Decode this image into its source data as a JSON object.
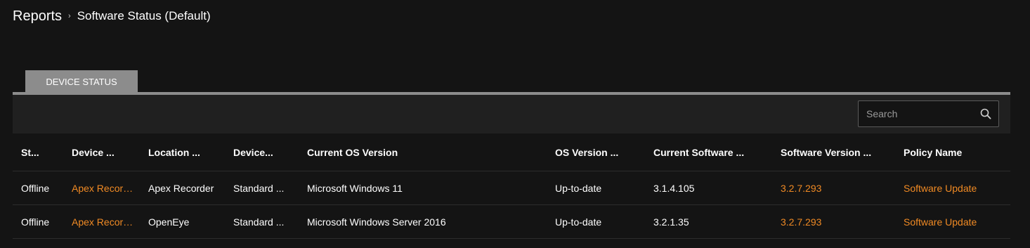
{
  "breadcrumb": {
    "root": "Reports",
    "separator": "›",
    "current": "Software Status (Default)"
  },
  "tabs": [
    {
      "label": "DEVICE STATUS",
      "active": true
    }
  ],
  "search": {
    "placeholder": "Search",
    "value": "",
    "icon": "search-icon"
  },
  "colors": {
    "background": "#141414",
    "toolbar": "#202020",
    "tab": "#8c8c8c",
    "accent": "#f08a24"
  },
  "table": {
    "columns": [
      "St...",
      "Device ...",
      "Location ...",
      "Device...",
      "Current OS Version",
      "OS Version ...",
      "Current Software ...",
      "Software Version ...",
      "Policy Name"
    ],
    "rows": [
      {
        "status": "Offline",
        "device": "Apex Recorder",
        "location": "Apex Recorder",
        "device_type": "Standard ...",
        "os_version": "Microsoft Windows 11",
        "os_status": "Up-to-date",
        "current_software": "3.1.4.105",
        "software_version": "3.2.7.293",
        "policy": "Software Update"
      },
      {
        "status": "Offline",
        "device": "Apex Recorder",
        "location": "OpenEye",
        "device_type": "Standard ...",
        "os_version": "Microsoft Windows Server 2016",
        "os_status": "Up-to-date",
        "current_software": "3.2.1.35",
        "software_version": "3.2.7.293",
        "policy": "Software Update"
      }
    ]
  }
}
